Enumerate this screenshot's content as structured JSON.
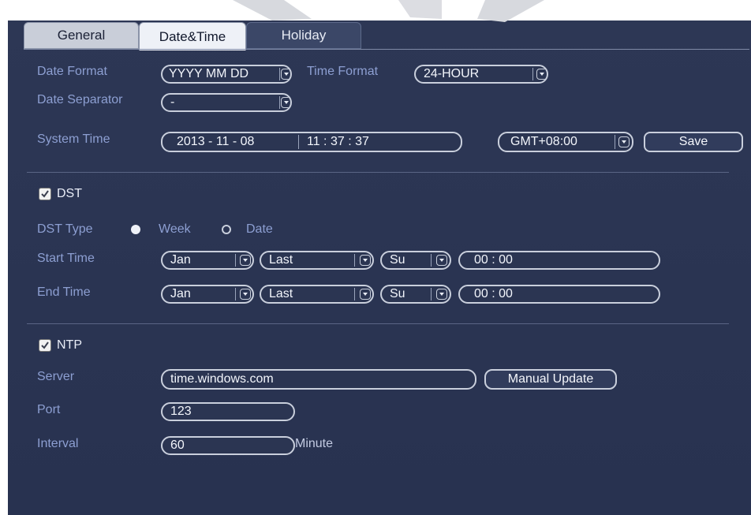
{
  "tabs": [
    {
      "label": "General"
    },
    {
      "label": "Date&Time"
    },
    {
      "label": "Holiday"
    }
  ],
  "date_format": {
    "label": "Date Format",
    "value": "YYYY MM DD"
  },
  "time_format": {
    "label": "Time Format",
    "value": "24-HOUR"
  },
  "date_separator": {
    "label": "Date Separator",
    "value": "-"
  },
  "system_time": {
    "label": "System Time",
    "date": "2013 - 11 - 08",
    "time": "11 : 37 : 37",
    "timezone": "GMT+08:00",
    "save_label": "Save"
  },
  "dst": {
    "label": "DST",
    "checked": true,
    "type_label": "DST Type",
    "week_label": "Week",
    "date_label": "Date",
    "selected_type": "Week",
    "start_label": "Start Time",
    "end_label": "End Time",
    "start": {
      "month": "Jan",
      "week": "Last",
      "day": "Su",
      "time": "00 :  00"
    },
    "end": {
      "month": "Jan",
      "week": "Last",
      "day": "Su",
      "time": "00 :  00"
    }
  },
  "ntp": {
    "label": "NTP",
    "checked": true,
    "server_label": "Server",
    "server": "time.windows.com",
    "manual_update_label": "Manual Update",
    "port_label": "Port",
    "port": "123",
    "interval_label": "Interval",
    "interval": "60",
    "interval_unit": "Minute"
  },
  "colors": {
    "panel": "#2a3450",
    "label": "#8d9fd2",
    "field_border": "#c9cfdc"
  }
}
